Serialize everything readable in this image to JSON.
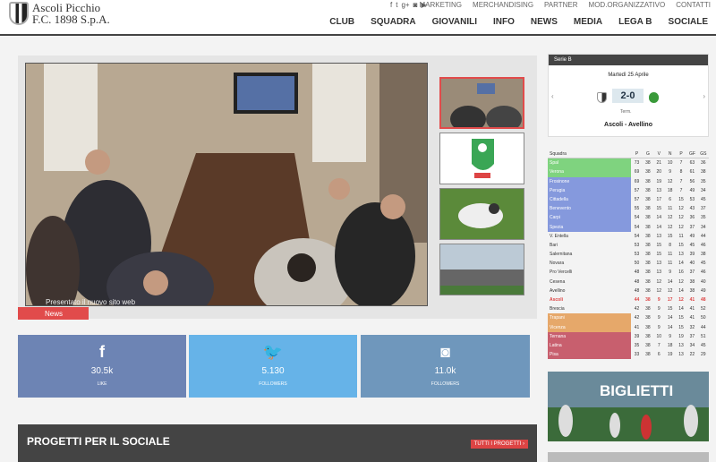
{
  "brand": {
    "line1": "Ascoli Picchio",
    "line2": "F.C. 1898 S.p.A."
  },
  "top_links": [
    "MARKETING",
    "MERCHANDISING",
    "PARTNER",
    "MOD.ORGANIZZATIVO",
    "CONTATTI"
  ],
  "nav": [
    "CLUB",
    "SQUADRA",
    "GIOVANILI",
    "INFO",
    "NEWS",
    "MEDIA",
    "LEGA B",
    "SOCIALE"
  ],
  "slider": {
    "caption": "Presentato il nuovo sito web",
    "tag": "News"
  },
  "social": [
    {
      "network": "facebook",
      "icon": "f",
      "count": "30.5k",
      "label": "LIKE",
      "color": "#6d84b4"
    },
    {
      "network": "twitter",
      "icon": "🐦",
      "count": "5.130",
      "label": "FOLLOWERS",
      "color": "#66b3e8"
    },
    {
      "network": "instagram",
      "icon": "◙",
      "count": "11.0k",
      "label": "FOLLOWERS",
      "color": "#6f97bc"
    }
  ],
  "sociale": {
    "title": "PROGETTI PER IL SOCIALE",
    "button": "TUTTI I PROGETTI ›"
  },
  "match": {
    "league": "Serie B",
    "date": "Martedì 25 Aprile",
    "score": "2-0",
    "status": "Term.",
    "teams": "Ascoli - Avellino"
  },
  "standings": {
    "headers": [
      "Squadra",
      "P",
      "G",
      "V",
      "N",
      "P",
      "GF",
      "GS"
    ],
    "rows": [
      {
        "team": "Spal",
        "vals": [
          "73",
          "38",
          "21",
          "10",
          "7",
          "63",
          "36"
        ],
        "color": "#7fd37f"
      },
      {
        "team": "Verona",
        "vals": [
          "69",
          "38",
          "20",
          "9",
          "8",
          "61",
          "38"
        ],
        "color": "#7fd37f"
      },
      {
        "team": "Frosinone",
        "vals": [
          "69",
          "38",
          "19",
          "12",
          "7",
          "56",
          "35"
        ],
        "color": "#8599dd"
      },
      {
        "team": "Perugia",
        "vals": [
          "57",
          "38",
          "13",
          "18",
          "7",
          "49",
          "34"
        ],
        "color": "#8599dd"
      },
      {
        "team": "Cittadella",
        "vals": [
          "57",
          "38",
          "17",
          "6",
          "15",
          "53",
          "45"
        ],
        "color": "#8599dd"
      },
      {
        "team": "Benevento",
        "vals": [
          "55",
          "38",
          "15",
          "11",
          "12",
          "43",
          "37"
        ],
        "color": "#8599dd"
      },
      {
        "team": "Carpi",
        "vals": [
          "54",
          "38",
          "14",
          "12",
          "12",
          "36",
          "35"
        ],
        "color": "#8599dd"
      },
      {
        "team": "Spezia",
        "vals": [
          "54",
          "38",
          "14",
          "12",
          "12",
          "37",
          "34"
        ],
        "color": "#8599dd"
      },
      {
        "team": "V. Entella",
        "vals": [
          "54",
          "38",
          "13",
          "15",
          "11",
          "49",
          "44"
        ],
        "color": ""
      },
      {
        "team": "Bari",
        "vals": [
          "53",
          "38",
          "15",
          "8",
          "15",
          "45",
          "46"
        ],
        "color": ""
      },
      {
        "team": "Salernitana",
        "vals": [
          "53",
          "38",
          "15",
          "11",
          "13",
          "39",
          "38"
        ],
        "color": ""
      },
      {
        "team": "Novara",
        "vals": [
          "50",
          "38",
          "13",
          "11",
          "14",
          "40",
          "45"
        ],
        "color": ""
      },
      {
        "team": "Pro Vercelli",
        "vals": [
          "48",
          "38",
          "13",
          "9",
          "16",
          "37",
          "46"
        ],
        "color": ""
      },
      {
        "team": "Cesena",
        "vals": [
          "48",
          "38",
          "12",
          "14",
          "12",
          "38",
          "40"
        ],
        "color": ""
      },
      {
        "team": "Avellino",
        "vals": [
          "48",
          "38",
          "12",
          "12",
          "14",
          "38",
          "49"
        ],
        "color": ""
      },
      {
        "team": "Ascoli",
        "vals": [
          "44",
          "38",
          "9",
          "17",
          "12",
          "41",
          "48"
        ],
        "color": "",
        "highlight": true
      },
      {
        "team": "Brescia",
        "vals": [
          "42",
          "38",
          "9",
          "15",
          "14",
          "41",
          "52"
        ],
        "color": ""
      },
      {
        "team": "Trapani",
        "vals": [
          "42",
          "38",
          "9",
          "14",
          "15",
          "41",
          "50"
        ],
        "color": "#e6a86a"
      },
      {
        "team": "Vicenza",
        "vals": [
          "41",
          "38",
          "9",
          "14",
          "15",
          "32",
          "44"
        ],
        "color": "#e6a86a"
      },
      {
        "team": "Ternana",
        "vals": [
          "39",
          "38",
          "10",
          "9",
          "19",
          "37",
          "51"
        ],
        "color": "#c85f6e"
      },
      {
        "team": "Latina",
        "vals": [
          "35",
          "38",
          "7",
          "18",
          "13",
          "34",
          "45"
        ],
        "color": "#c85f6e"
      },
      {
        "team": "Pisa",
        "vals": [
          "33",
          "38",
          "6",
          "19",
          "13",
          "22",
          "29"
        ],
        "color": "#c85f6e"
      }
    ]
  },
  "biglietti": {
    "label": "BIGLIETTI"
  }
}
